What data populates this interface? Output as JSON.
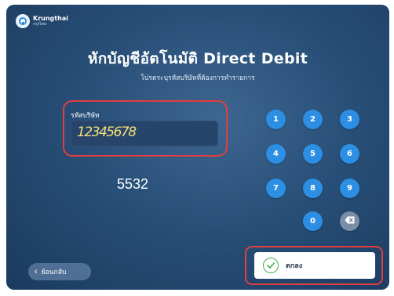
{
  "brand": {
    "name": "Krungthai",
    "sub": "กรุงไทย",
    "logo_icon": "elephant-icon"
  },
  "header": {
    "title": "หักบัญชีอัตโนมัติ Direct Debit",
    "subtitle": "โปรดระบุรหัสบริษัทที่ต้องการทำรายการ"
  },
  "form": {
    "label": "รหัสบริษัท",
    "value": "12345678"
  },
  "annotation": {
    "number": "5532"
  },
  "keypad": {
    "keys": [
      "1",
      "2",
      "3",
      "4",
      "5",
      "6",
      "7",
      "8",
      "9",
      "0"
    ],
    "delete_icon": "backspace-icon"
  },
  "footer": {
    "back_label": "ย้อนกลับ",
    "back_icon": "chevron-left-icon",
    "ok_label": "ตกลง",
    "ok_icon": "check-circle-icon"
  },
  "colors": {
    "background": "#284f78",
    "key": "#2c8fe3",
    "delete_key": "#7a8ea8",
    "annotation": "#e33d3d",
    "ok_check": "#3db24a",
    "field_text": "#f4e07a"
  }
}
